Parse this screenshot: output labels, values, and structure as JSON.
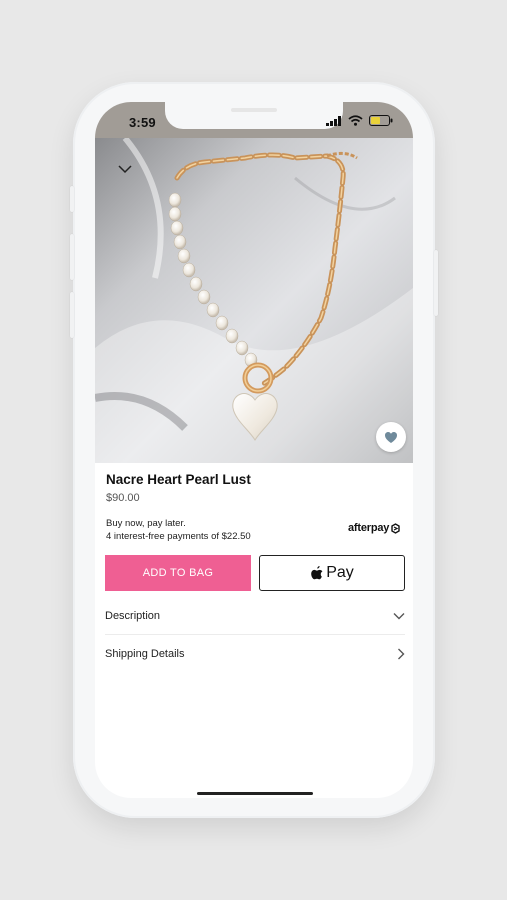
{
  "status_bar": {
    "time": "3:59"
  },
  "product": {
    "name": "Nacre Heart Pearl Lust",
    "price": "$90.00",
    "bnpl_line1": "Buy now, pay later.",
    "bnpl_line2": "4 interest-free payments of $22.50",
    "bnpl_provider": "afterpay"
  },
  "actions": {
    "add_to_bag": "ADD TO BAG",
    "apple_pay": "Pay"
  },
  "details": {
    "description_label": "Description",
    "shipping_label": "Shipping Details"
  },
  "colors": {
    "accent": "#ef5f93",
    "status_bar": "#a19c96",
    "favorite_heart": "#6f8a9b"
  },
  "icons": [
    "chevron-down-icon",
    "heart-icon",
    "apple-logo-icon",
    "afterpay-logo-icon",
    "chevron-right-icon",
    "wifi-icon",
    "signal-icon",
    "battery-icon"
  ]
}
